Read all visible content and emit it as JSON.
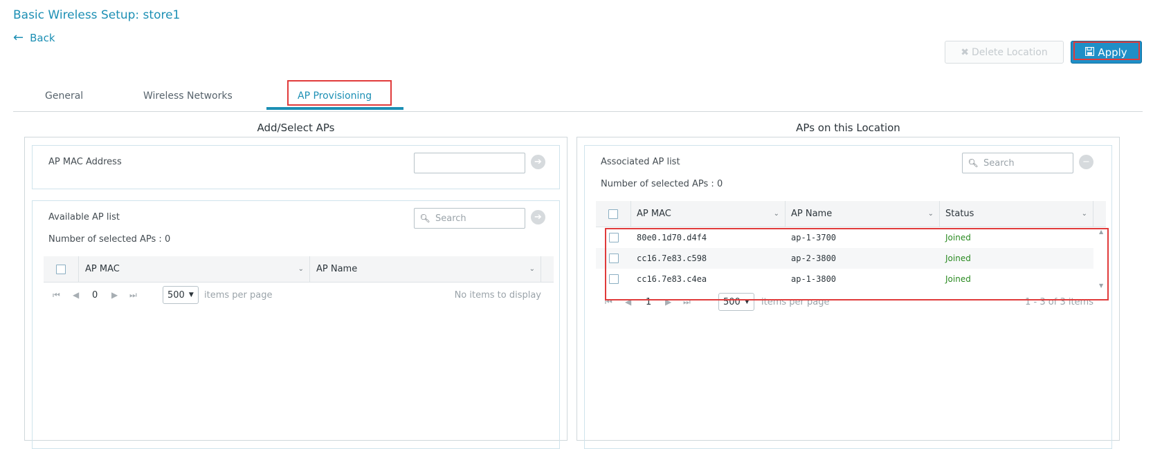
{
  "page": {
    "title": "Basic Wireless Setup: store1",
    "back_label": "Back",
    "delete_label": "Delete Location",
    "apply_label": "Apply"
  },
  "tabs": [
    {
      "label": "General",
      "active": false
    },
    {
      "label": "Wireless Networks",
      "active": false
    },
    {
      "label": "AP Provisioning",
      "active": true
    }
  ],
  "left_panel": {
    "title": "Add/Select APs",
    "mac_label": "AP MAC Address",
    "mac_value": "",
    "available_label": "Available AP list",
    "selected_count": "Number of selected APs : 0",
    "search_placeholder": "Search",
    "columns": [
      "AP MAC",
      "AP Name"
    ],
    "rows": [],
    "page_number": "0",
    "page_size": "500",
    "items_per_page": "items per page",
    "empty_text": "No items to display"
  },
  "right_panel": {
    "title": "APs on this Location",
    "associated_label": "Associated AP list",
    "selected_count": "Number of selected APs : 0",
    "search_placeholder": "Search",
    "columns": [
      "AP MAC",
      "AP Name",
      "Status"
    ],
    "rows": [
      {
        "mac": "80e0.1d70.d4f4",
        "name": "ap-1-3700",
        "status": "Joined"
      },
      {
        "mac": "cc16.7e83.c598",
        "name": "ap-2-3800",
        "status": "Joined"
      },
      {
        "mac": "cc16.7e83.c4ea",
        "name": "ap-1-3800",
        "status": "Joined"
      }
    ],
    "page_number": "1",
    "page_size": "500",
    "items_per_page": "items per page",
    "range_text": "1 - 3 of 3 items"
  },
  "colors": {
    "accent": "#1c8fb4",
    "apply_bg": "#1f8fc7",
    "highlight": "#e03a3a",
    "joined": "#2a8a21"
  },
  "icons": {
    "back": "arrow-left-icon",
    "delete": "x-icon",
    "apply": "save-icon",
    "search": "magnifier-icon",
    "go": "arrow-circle-right-icon",
    "remove": "minus-circle-icon"
  }
}
